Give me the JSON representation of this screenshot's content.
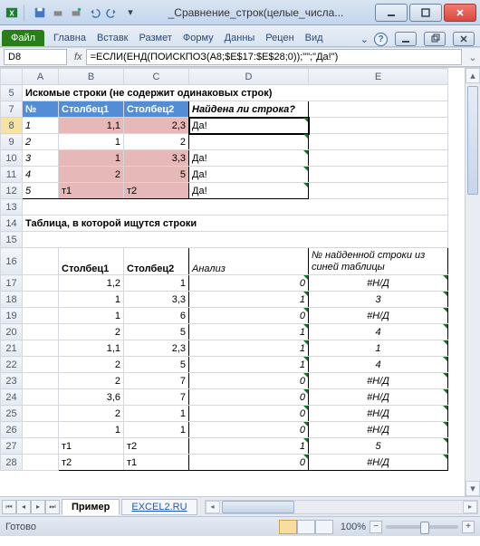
{
  "title": "_Сравнение_строк(целые_числа...",
  "qat_icons": [
    "excel",
    "save",
    "print",
    "email",
    "undo",
    "redo"
  ],
  "win_controls": [
    "minimize",
    "maximize",
    "close"
  ],
  "file_tab": "Файл",
  "ribbon_tabs": [
    "Главна",
    "Вставк",
    "Размет",
    "Форму",
    "Данны",
    "Рецен",
    "Вид"
  ],
  "ribbon_caret": "⌄",
  "help": "?",
  "namebox": "D8",
  "fx_label": "fx",
  "formula": "=ЕСЛИ(ЕНД(ПОИСКПОЗ(A8;$E$17:$E$28;0));\"\";\"Да!\")",
  "cols": [
    "A",
    "B",
    "C",
    "D",
    "E"
  ],
  "rows": {
    "r5": {
      "A": "Искомые строки (не содержит одинаковых строк)"
    },
    "r7": {
      "A": "№",
      "B": "Столбец1",
      "C": "Столбец2",
      "D": "Найдена ли строка?"
    },
    "r8": {
      "A": "1",
      "B": "1,1",
      "C": "2,3",
      "D": "Да!"
    },
    "r9": {
      "A": "2",
      "B": "1",
      "C": "2",
      "D": ""
    },
    "r10": {
      "A": "3",
      "B": "1",
      "C": "3,3",
      "D": "Да!"
    },
    "r11": {
      "A": "4",
      "B": "2",
      "C": "5",
      "D": "Да!"
    },
    "r12": {
      "A": "5",
      "B": "т1",
      "C": "т2",
      "D": "Да!"
    },
    "r14": {
      "A": "Таблица, в которой ищутся строки"
    },
    "r16": {
      "B": "Столбец1",
      "C": "Столбец2",
      "D": "Анализ",
      "E": "№ найденной строки из синей таблицы"
    },
    "r17": {
      "B": "1,2",
      "C": "1",
      "D": "0",
      "E": "#Н/Д"
    },
    "r18": {
      "B": "1",
      "C": "3,3",
      "D": "1",
      "E": "3"
    },
    "r19": {
      "B": "1",
      "C": "6",
      "D": "0",
      "E": "#Н/Д"
    },
    "r20": {
      "B": "2",
      "C": "5",
      "D": "1",
      "E": "4"
    },
    "r21": {
      "B": "1,1",
      "C": "2,3",
      "D": "1",
      "E": "1"
    },
    "r22": {
      "B": "2",
      "C": "5",
      "D": "1",
      "E": "4"
    },
    "r23": {
      "B": "2",
      "C": "7",
      "D": "0",
      "E": "#Н/Д"
    },
    "r24": {
      "B": "3,6",
      "C": "7",
      "D": "0",
      "E": "#Н/Д"
    },
    "r25": {
      "B": "2",
      "C": "1",
      "D": "0",
      "E": "#Н/Д"
    },
    "r26": {
      "B": "1",
      "C": "1",
      "D": "0",
      "E": "#Н/Д"
    },
    "r27": {
      "B": "т1",
      "C": "т2",
      "D": "1",
      "E": "5"
    },
    "r28": {
      "B": "т2",
      "C": "т1",
      "D": "0",
      "E": "#Н/Д"
    }
  },
  "row_nums": [
    "5",
    "7",
    "8",
    "9",
    "10",
    "11",
    "12",
    "13",
    "14",
    "15",
    "16",
    "17",
    "18",
    "19",
    "20",
    "21",
    "22",
    "23",
    "24",
    "25",
    "26",
    "27",
    "28"
  ],
  "sheet_tabs": {
    "active": "Пример",
    "link": "EXCEL2.RU"
  },
  "status": "Готово",
  "zoom": "100%",
  "zoom_minus": "−",
  "zoom_plus": "+"
}
